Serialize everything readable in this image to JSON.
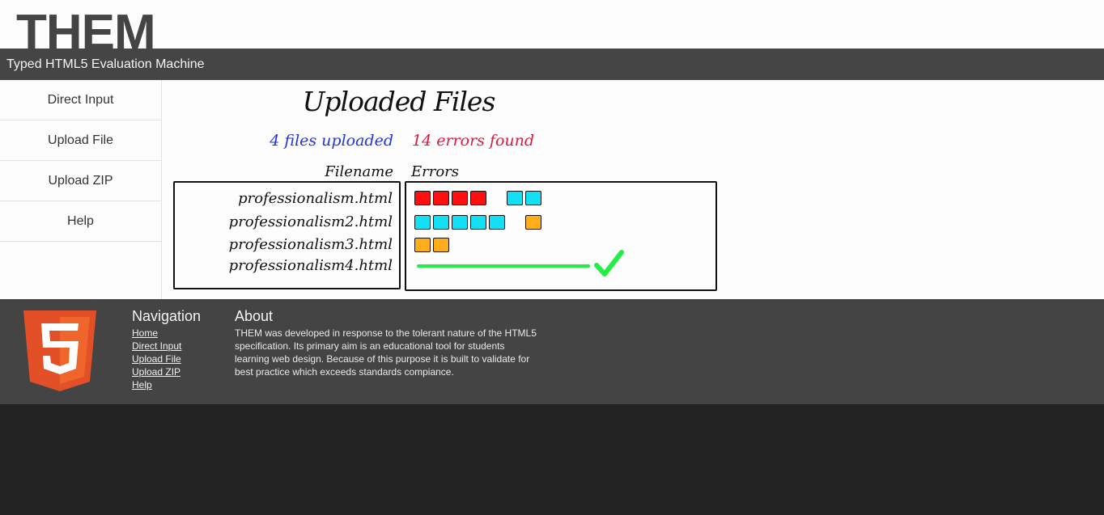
{
  "header": {
    "logo": "THEM",
    "subtitle": "Typed HTML5 Evaluation Machine"
  },
  "sidebar": {
    "items": [
      {
        "label": "Direct Input"
      },
      {
        "label": "Upload File"
      },
      {
        "label": "Upload ZIP"
      },
      {
        "label": "Help"
      }
    ]
  },
  "main": {
    "heading": "Uploaded Files",
    "files_count": "4 files uploaded",
    "errors_count": "14 errors found",
    "col_filename": "Filename",
    "col_errors": "Errors",
    "files": [
      {
        "name": "professionalism.html",
        "errors": [
          "red",
          "red",
          "red",
          "red",
          "gap",
          "cyan",
          "cyan"
        ]
      },
      {
        "name": "professionalism2.html",
        "errors": [
          "cyan",
          "cyan",
          "cyan",
          "cyan",
          "cyan",
          "gap",
          "orange"
        ]
      },
      {
        "name": "professionalism3.html",
        "errors": [
          "orange",
          "orange"
        ]
      },
      {
        "name": "professionalism4.html",
        "errors": [],
        "passed": true
      }
    ],
    "colors": {
      "red": "#ff0f0f",
      "cyan": "#13e0f4",
      "orange": "#ffad1a",
      "pass": "#22ee44"
    }
  },
  "footer": {
    "logo_icon": "html5-logo-icon",
    "nav_heading": "Navigation",
    "nav_links": [
      {
        "label": "Home"
      },
      {
        "label": "Direct Input"
      },
      {
        "label": "Upload File"
      },
      {
        "label": "Upload ZIP"
      },
      {
        "label": "Help"
      }
    ],
    "about_heading": "About",
    "about_lines": [
      "THEM was developed in response to the tolerant nature of the HTML5",
      "specification. Its primary aim is an educational tool for students",
      "learning web design. Because of this purpose it is built to validate for",
      "best practice which exceeds standards compiance."
    ]
  }
}
